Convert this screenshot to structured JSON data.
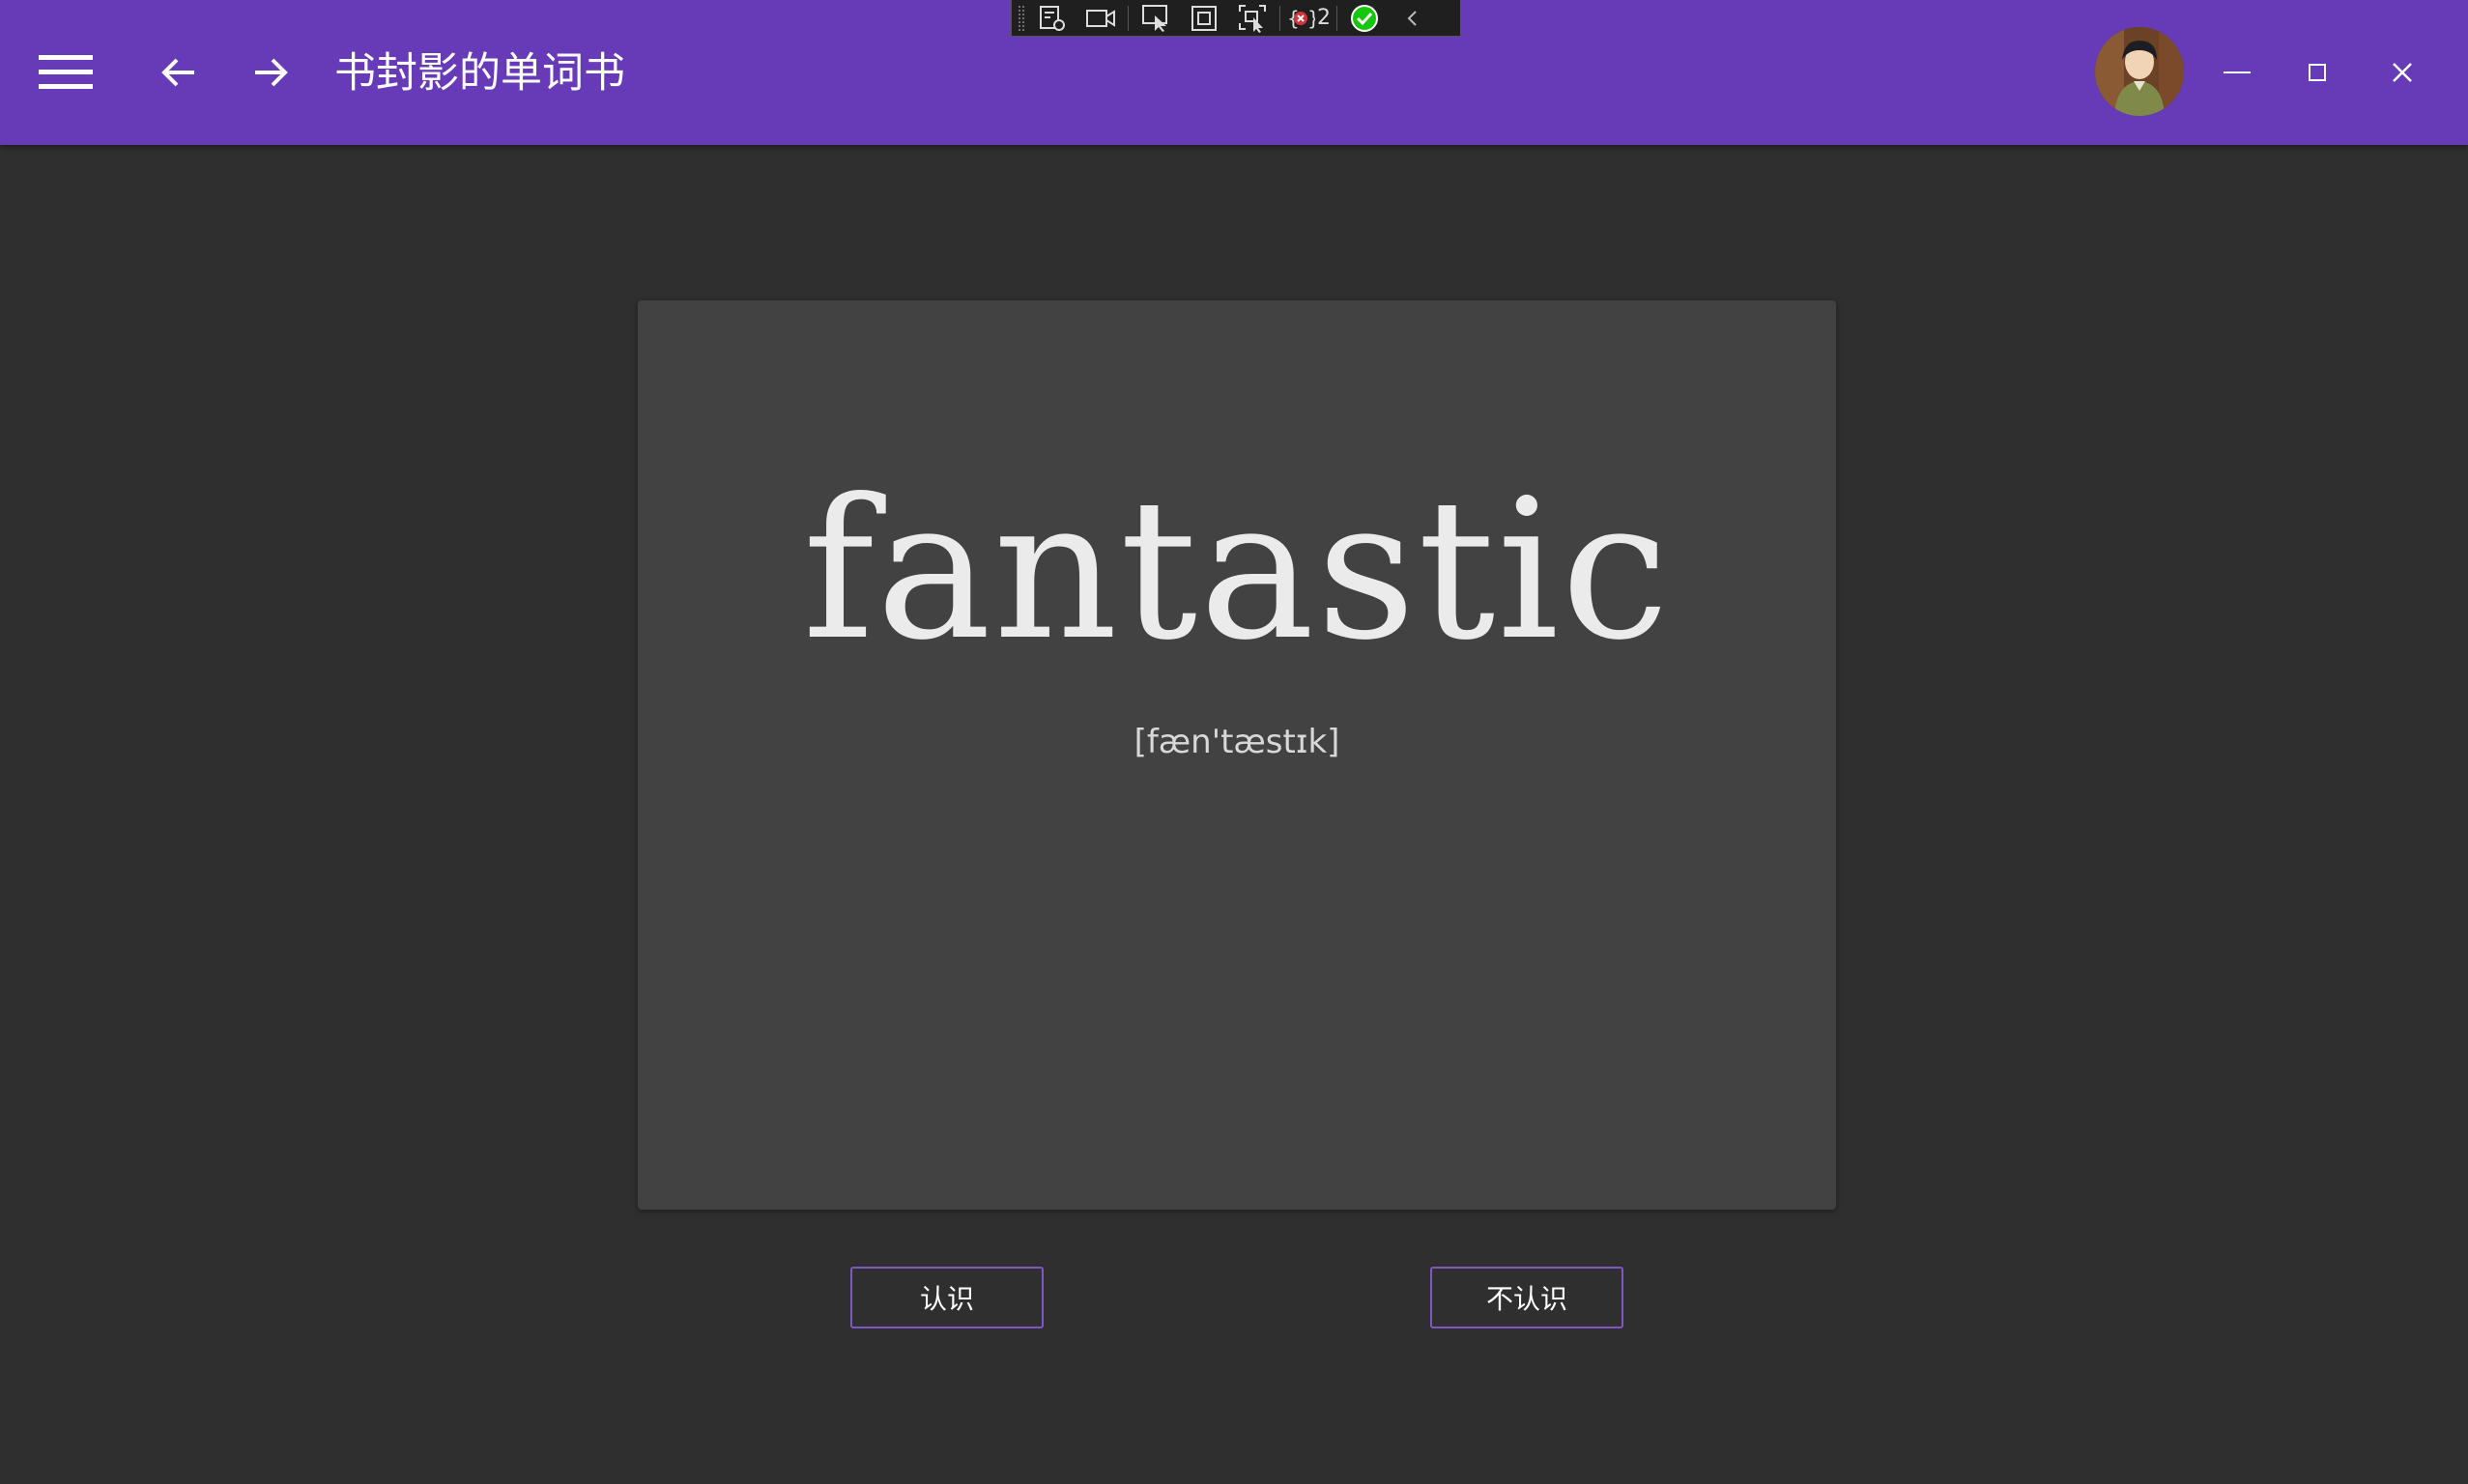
{
  "app": {
    "title": "书封影的单词书"
  },
  "debug_toolbar": {
    "error_count": "2"
  },
  "card": {
    "word": "fantastic",
    "phonetic": "[fæn'tæstɪk]"
  },
  "actions": {
    "know_label": "认识",
    "dont_know_label": "不认识"
  },
  "colors": {
    "app_bar": "#673ab7",
    "background": "#2f2f2f",
    "card": "#424242",
    "button_border": "#7e57c2"
  },
  "icons": {
    "menu": "hamburger-icon",
    "back": "arrow-left-icon",
    "forward": "arrow-right-icon",
    "minimize": "minimize-icon",
    "maximize": "maximize-icon",
    "close": "close-icon"
  }
}
